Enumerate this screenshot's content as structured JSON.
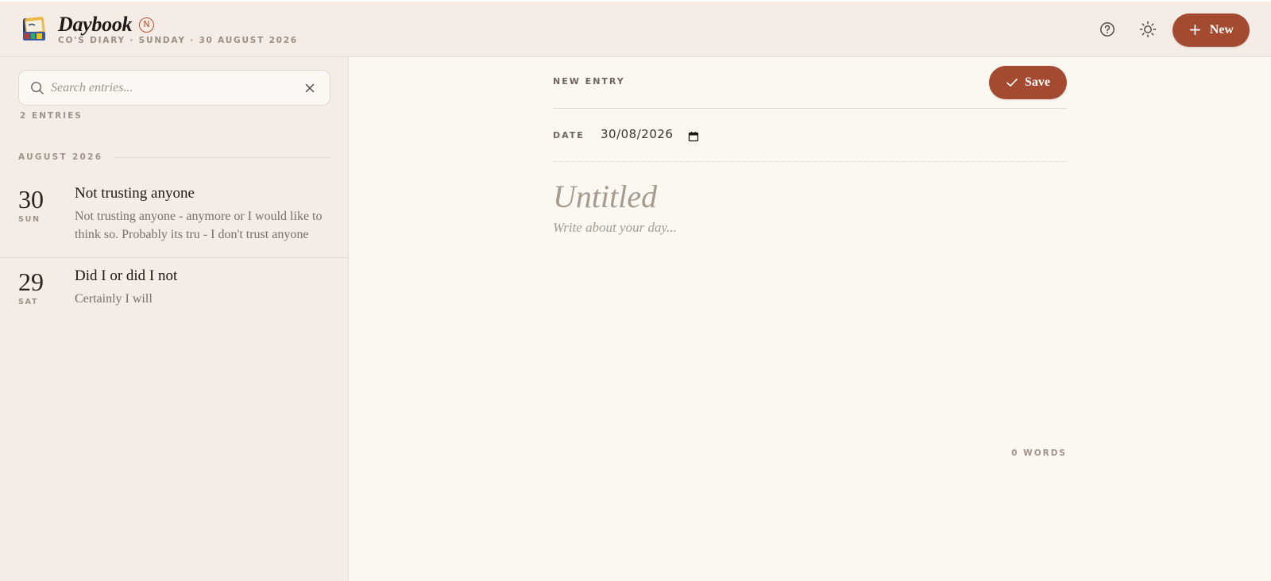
{
  "header": {
    "app_title": "Daybook",
    "badge": "N",
    "subtitle": "CO'S DIARY · SUNDAY · 30 AUGUST 2026",
    "new_button": "New"
  },
  "sidebar": {
    "search_placeholder": "Search entries...",
    "entry_count": "2 ENTRIES",
    "month_label": "AUGUST 2026",
    "entries": [
      {
        "day": "30",
        "weekday": "SUN",
        "title": "Not trusting anyone",
        "excerpt": "Not trusting anyone - anymore or I would like to think so. Probably its tru - I don't trust anyone"
      },
      {
        "day": "29",
        "weekday": "SAT",
        "title": "Did I or did I not",
        "excerpt": "Certainly I will"
      }
    ]
  },
  "editor": {
    "section_label": "NEW ENTRY",
    "save_button": "Save",
    "date_label": "DATE",
    "date_value": "30/08/2026",
    "title_placeholder": "Untitled",
    "body_placeholder": "Write about your day...",
    "word_count": "0 WORDS"
  },
  "colors": {
    "accent": "#a34a30",
    "background": "#fbf8f2",
    "sidebar": "#f4ede5"
  }
}
